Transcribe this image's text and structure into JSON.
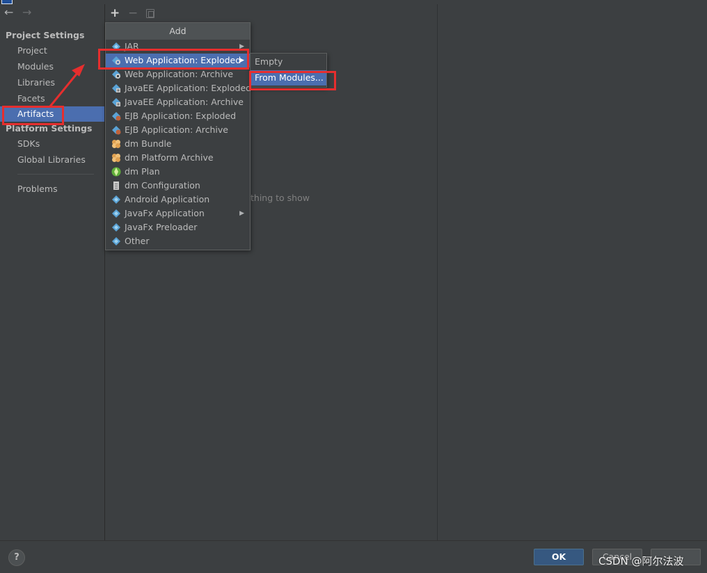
{
  "sidebar": {
    "project_settings_header": "Project Settings",
    "project_items": [
      {
        "label": "Project"
      },
      {
        "label": "Modules"
      },
      {
        "label": "Libraries"
      },
      {
        "label": "Facets"
      },
      {
        "label": "Artifacts",
        "selected": true
      }
    ],
    "platform_settings_header": "Platform Settings",
    "platform_items": [
      {
        "label": "SDKs"
      },
      {
        "label": "Global Libraries"
      }
    ],
    "problems_label": "Problems"
  },
  "toolbar": {
    "add_icon": "plus-icon",
    "remove_icon": "minus-icon",
    "copy_icon": "copy-icon"
  },
  "main": {
    "empty_text_visible": "thing to show"
  },
  "add_menu": {
    "title": "Add",
    "items": [
      {
        "label": "JAR",
        "has_submenu": true,
        "icon": "artifact-icon"
      },
      {
        "label": "Web Application: Exploded",
        "has_submenu": true,
        "highlighted": true,
        "icon": "web-artifact-icon"
      },
      {
        "label": "Web Application: Archive",
        "icon": "web-artifact-icon"
      },
      {
        "label": "JavaEE Application: Exploded",
        "icon": "javaee-icon"
      },
      {
        "label": "JavaEE Application: Archive",
        "icon": "javaee-icon"
      },
      {
        "label": "EJB Application: Exploded",
        "icon": "ejb-icon"
      },
      {
        "label": "EJB Application: Archive",
        "icon": "ejb-icon"
      },
      {
        "label": "dm Bundle",
        "icon": "dm-bundle-icon"
      },
      {
        "label": "dm Platform Archive",
        "icon": "dm-bundle-icon"
      },
      {
        "label": "dm Plan",
        "icon": "dm-plan-icon"
      },
      {
        "label": "dm Configuration",
        "icon": "dm-config-icon"
      },
      {
        "label": "Android Application",
        "icon": "artifact-icon"
      },
      {
        "label": "JavaFx Application",
        "has_submenu": true,
        "icon": "artifact-icon"
      },
      {
        "label": "JavaFx Preloader",
        "icon": "artifact-icon"
      },
      {
        "label": "Other",
        "icon": "artifact-icon"
      }
    ]
  },
  "submenu": {
    "items": [
      {
        "label": "Empty"
      },
      {
        "label": "From Modules...",
        "highlighted": true
      }
    ]
  },
  "footer": {
    "help_label": "?",
    "ok_label": "OK",
    "cancel_label": "Cancel"
  },
  "watermark": "CSDN @阿尔法波",
  "colors": {
    "background": "#3c3f41",
    "selection": "#4b6eaf",
    "annotation_red": "#e62e2e",
    "ok_button": "#365880"
  }
}
